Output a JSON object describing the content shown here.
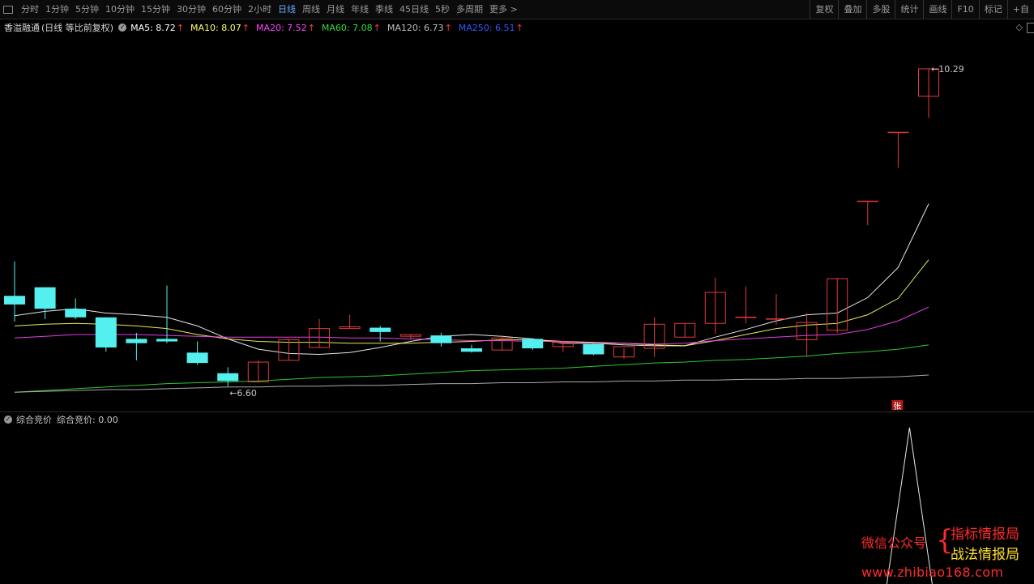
{
  "toolbar": {
    "periods": [
      "分时",
      "1分钟",
      "5分钟",
      "10分钟",
      "15分钟",
      "30分钟",
      "60分钟",
      "2小时",
      "日线",
      "周线",
      "月线",
      "年线",
      "季线",
      "45日线",
      "5秒",
      "多周期",
      "更多 >"
    ],
    "active_period": "日线",
    "right_items": [
      "复权",
      "叠加",
      "多股",
      "统计",
      "画线",
      "F10",
      "标记",
      "+自"
    ]
  },
  "stock": {
    "name": "香溢融通",
    "mode": "(日线 等比前复权)"
  },
  "ma_indicators": [
    {
      "label": "MA5: 8.72",
      "color": "#ffffff"
    },
    {
      "label": "MA10: 8.07",
      "color": "#ffff66"
    },
    {
      "label": "MA20: 7.52",
      "color": "#ff44ff"
    },
    {
      "label": "MA60: 7.08",
      "color": "#33dd33"
    },
    {
      "label": "MA120: 6.73",
      "color": "#bbbbbb"
    },
    {
      "label": "MA250: 6.51",
      "color": "#3355ff"
    }
  ],
  "ma_arrow": "↑",
  "price_labels": {
    "high": "10.29",
    "low": "6.60"
  },
  "zhang_badge": "张",
  "sub_indicator": {
    "name": "综合竞价",
    "value_label": "综合竞价: 0.00"
  },
  "watermark": {
    "label": "微信公众号",
    "brace": "{",
    "line1": "指标情报局",
    "line2": "战法情报局",
    "url": "www.zhibiao168.com"
  },
  "chart_data": {
    "type": "candlestick",
    "price_range": [
      6.4,
      10.6
    ],
    "candles": [
      {
        "o": 7.65,
        "h": 8.05,
        "l": 7.35,
        "c": 7.55
      },
      {
        "o": 7.75,
        "h": 7.75,
        "l": 7.38,
        "c": 7.5
      },
      {
        "o": 7.5,
        "h": 7.62,
        "l": 7.38,
        "c": 7.4
      },
      {
        "o": 7.4,
        "h": 7.4,
        "l": 7.0,
        "c": 7.05
      },
      {
        "o": 7.15,
        "h": 7.22,
        "l": 6.9,
        "c": 7.1
      },
      {
        "o": 7.15,
        "h": 7.77,
        "l": 7.1,
        "c": 7.12
      },
      {
        "o": 6.99,
        "h": 7.12,
        "l": 6.85,
        "c": 6.87
      },
      {
        "o": 6.75,
        "h": 6.82,
        "l": 6.6,
        "c": 6.66
      },
      {
        "o": 6.65,
        "h": 6.9,
        "l": 6.65,
        "c": 6.88
      },
      {
        "o": 6.9,
        "h": 7.15,
        "l": 6.9,
        "c": 7.14
      },
      {
        "o": 7.05,
        "h": 7.38,
        "l": 7.05,
        "c": 7.27
      },
      {
        "o": 7.27,
        "h": 7.43,
        "l": 7.27,
        "c": 7.29
      },
      {
        "o": 7.28,
        "h": 7.3,
        "l": 7.12,
        "c": 7.23
      },
      {
        "o": 7.18,
        "h": 7.2,
        "l": 7.14,
        "c": 7.2
      },
      {
        "o": 7.19,
        "h": 7.22,
        "l": 7.06,
        "c": 7.1
      },
      {
        "o": 7.04,
        "h": 7.08,
        "l": 6.99,
        "c": 7.0
      },
      {
        "o": 7.02,
        "h": 7.19,
        "l": 7.02,
        "c": 7.16
      },
      {
        "o": 7.15,
        "h": 7.16,
        "l": 7.02,
        "c": 7.04
      },
      {
        "o": 7.06,
        "h": 7.12,
        "l": 7.0,
        "c": 7.11
      },
      {
        "o": 7.09,
        "h": 7.1,
        "l": 6.96,
        "c": 6.97
      },
      {
        "o": 6.94,
        "h": 7.04,
        "l": 6.92,
        "c": 7.06
      },
      {
        "o": 7.04,
        "h": 7.4,
        "l": 6.94,
        "c": 7.32
      },
      {
        "o": 7.17,
        "h": 7.33,
        "l": 7.17,
        "c": 7.33
      },
      {
        "o": 7.33,
        "h": 7.86,
        "l": 7.21,
        "c": 7.69
      },
      {
        "o": 7.4,
        "h": 7.76,
        "l": 7.33,
        "c": 7.4
      },
      {
        "o": 7.38,
        "h": 7.67,
        "l": 7.31,
        "c": 7.38
      },
      {
        "o": 7.14,
        "h": 7.45,
        "l": 6.94,
        "c": 7.34
      },
      {
        "o": 7.25,
        "h": 7.85,
        "l": 7.22,
        "c": 7.85
      },
      {
        "o": 8.75,
        "h": 8.75,
        "l": 8.47,
        "c": 8.75
      },
      {
        "o": 9.55,
        "h": 9.55,
        "l": 9.14,
        "c": 9.55
      },
      {
        "o": 9.97,
        "h": 10.29,
        "l": 9.72,
        "c": 10.29
      }
    ],
    "ma_series": [
      {
        "name": "MA5",
        "color": "#ffffff",
        "values": [
          7.42,
          7.47,
          7.5,
          7.45,
          7.43,
          7.4,
          7.3,
          7.15,
          7.03,
          6.98,
          6.97,
          6.99,
          7.05,
          7.12,
          7.18,
          7.2,
          7.18,
          7.15,
          7.1,
          7.1,
          7.08,
          7.07,
          7.07,
          7.17,
          7.26,
          7.36,
          7.43,
          7.45,
          7.63,
          7.98,
          8.72
        ]
      },
      {
        "name": "MA10",
        "color": "#ffff66",
        "values": [
          7.3,
          7.32,
          7.33,
          7.32,
          7.3,
          7.27,
          7.2,
          7.15,
          7.12,
          7.11,
          7.11,
          7.1,
          7.1,
          7.1,
          7.11,
          7.12,
          7.14,
          7.14,
          7.12,
          7.11,
          7.1,
          7.08,
          7.07,
          7.13,
          7.2,
          7.27,
          7.31,
          7.33,
          7.43,
          7.62,
          8.07
        ]
      },
      {
        "name": "MA20",
        "color": "#ff44ff",
        "values": [
          7.16,
          7.18,
          7.2,
          7.2,
          7.2,
          7.19,
          7.18,
          7.17,
          7.17,
          7.17,
          7.17,
          7.16,
          7.16,
          7.15,
          7.14,
          7.13,
          7.13,
          7.12,
          7.12,
          7.1,
          7.1,
          7.09,
          7.1,
          7.13,
          7.15,
          7.17,
          7.19,
          7.2,
          7.26,
          7.36,
          7.52
        ]
      },
      {
        "name": "MA60",
        "color": "#33dd33",
        "values": [
          6.53,
          6.55,
          6.57,
          6.59,
          6.61,
          6.63,
          6.64,
          6.65,
          6.66,
          6.68,
          6.7,
          6.71,
          6.72,
          6.74,
          6.76,
          6.78,
          6.79,
          6.8,
          6.81,
          6.83,
          6.85,
          6.87,
          6.88,
          6.9,
          6.91,
          6.93,
          6.95,
          6.98,
          7.0,
          7.03,
          7.08
        ]
      },
      {
        "name": "MA120",
        "color": "#bbbbbb",
        "values": [
          6.53,
          6.54,
          6.55,
          6.56,
          6.56,
          6.57,
          6.58,
          6.59,
          6.59,
          6.6,
          6.6,
          6.61,
          6.61,
          6.62,
          6.63,
          6.63,
          6.64,
          6.64,
          6.65,
          6.65,
          6.66,
          6.66,
          6.67,
          6.67,
          6.68,
          6.68,
          6.69,
          6.69,
          6.7,
          6.71,
          6.73
        ]
      }
    ],
    "sub_series": {
      "name": "综合竞价",
      "values": [
        0,
        0,
        0,
        0,
        0,
        0,
        0,
        0,
        0,
        0,
        0,
        0,
        0,
        0,
        0,
        0,
        0,
        0,
        0,
        0,
        0,
        0,
        0,
        0,
        0,
        0,
        0,
        0,
        0,
        1,
        0
      ],
      "range": [
        0,
        1
      ]
    }
  }
}
